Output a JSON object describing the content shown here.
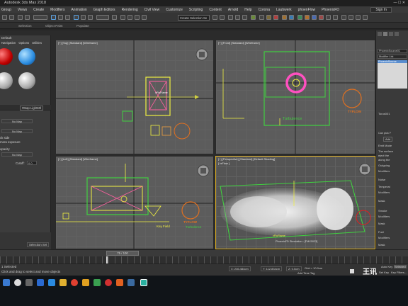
{
  "app": {
    "title": "Autodesk 3ds Max 2018",
    "sign_in": "Sign In"
  },
  "menu": [
    "Group",
    "Views",
    "Create",
    "Modifiers",
    "Animation",
    "Graph Editors",
    "Rendering",
    "Civil View",
    "Customize",
    "Scripting",
    "Content",
    "Arnold",
    "Help",
    "Corona",
    "Laubwerk",
    "phoenFlow",
    "PhoenixFD"
  ],
  "toolbar": {
    "selection_set": "Create Selection Se"
  },
  "ribbon": {
    "items": [
      "Selection",
      "Object Paint",
      "Populate"
    ]
  },
  "material_editor": {
    "title": "Default",
    "tabs": [
      "Navigation",
      "Options",
      "Utilities"
    ],
    "map_name": "#Map LightMtl",
    "no_map_1": "No Map",
    "no_map_2": "No Map",
    "opt_1": "ck side",
    "opt_2": "mera exposure",
    "opt_3": "opacity",
    "no_map_3": "No Map",
    "cutoff_label": "Cutoff:",
    "cutoff_value": "0.0"
  },
  "viewports": {
    "top": "[+] [Top] [Standard] [Wireframe]",
    "front": "[+] [Front] [Standard] [Wireframe]",
    "left": "[+] [Left] [Standard] [Wireframe]",
    "perspective": "[+] [Perspective] [Standard] [Default Shading]",
    "perspective_sub": "[ txFlow ]",
    "front_label": "Turbulence",
    "left_label_1": "Key Field",
    "left_label_2": "Turbulence",
    "persp_label_1": "vFluFlame",
    "persp_label_2": "PhoenixFD Simulation : [FMX0023]",
    "logo_text": "TYFLOW"
  },
  "command_panel": {
    "object_name": "PhoenixSource01",
    "modifier_list": "Modifier List",
    "stack_item": "PhoenixSource",
    "rows": [
      "Torus001",
      "Add",
      "Emit Mode",
      "The surface",
      "eject the",
      "along the",
      "Outgoing",
      "Modifiers",
      "Noise",
      "Temperat",
      "Modifiers",
      "Mask",
      "Smoke",
      "Modifiers",
      "Mask",
      "Fuel",
      "Modifiers",
      "Mask",
      "RGB",
      "Modifiers",
      "Map",
      "Particles",
      "Modifiers"
    ],
    "pick_label": "Can pick F"
  },
  "timeline": {
    "frame": "75 / 100"
  },
  "status": {
    "selected": "1 Selected",
    "hint": "Click and drag to select and move objects",
    "selection_set": "Selection Set",
    "add_time_tag": "Add Time Tag",
    "auto_key": "Auto Key",
    "set_key": "Set Key",
    "selected_dd": "Selected",
    "key_filters": "Key Filters...",
    "x": "X: 236.484cm",
    "y": "Y: 112.834cm",
    "z": "Z: 0.0cm",
    "grid": "Grid = 10.0cm"
  },
  "watermark": "王讯"
}
